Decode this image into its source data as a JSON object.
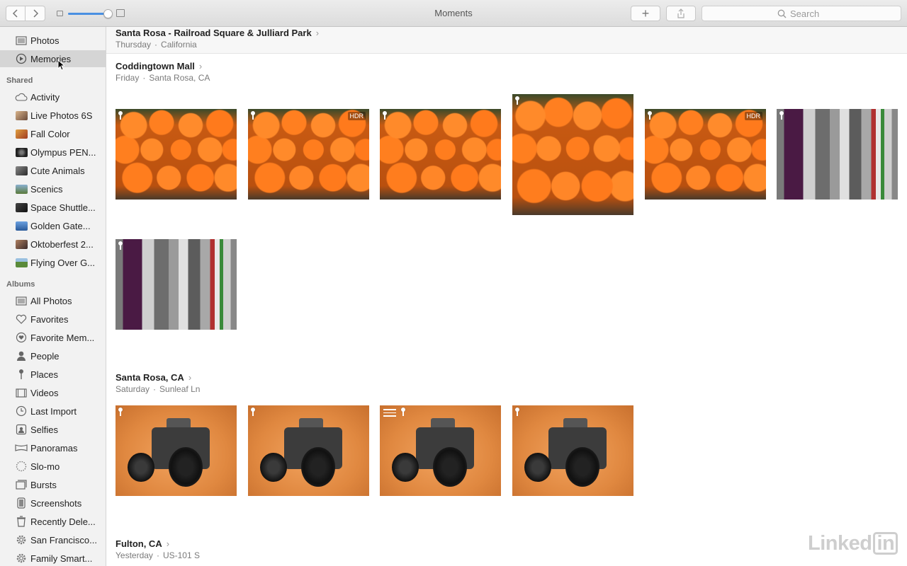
{
  "window": {
    "title": "Moments"
  },
  "toolbar": {
    "back_icon": "chevron-left-icon",
    "forward_icon": "chevron-right-icon",
    "add_label": "+",
    "search_placeholder": "Search"
  },
  "sidebar": {
    "top_items": [
      {
        "label": "Photos",
        "icon": "photos-icon"
      },
      {
        "label": "Memories",
        "icon": "memories-icon",
        "selected": true
      }
    ],
    "shared_heading": "Shared",
    "shared_items": [
      {
        "label": "Activity",
        "icon": "cloud-icon"
      },
      {
        "label": "Live Photos 6S",
        "icon": "album-thumb-icon",
        "color": "#8a6a5a"
      },
      {
        "label": "Fall Color",
        "icon": "album-thumb-icon",
        "color": "#b5652a"
      },
      {
        "label": "Olympus PEN...",
        "icon": "album-thumb-icon",
        "color": "#3a3a3a"
      },
      {
        "label": "Cute Animals",
        "icon": "album-thumb-icon",
        "color": "#4a4a4a"
      },
      {
        "label": "Scenics",
        "icon": "album-thumb-icon",
        "color": "#5a6a4a"
      },
      {
        "label": "Space Shuttle...",
        "icon": "album-thumb-icon",
        "color": "#2a2a3a"
      },
      {
        "label": "Golden Gate...",
        "icon": "album-thumb-icon",
        "color": "#4a7ab0"
      },
      {
        "label": "Oktoberfest 2...",
        "icon": "album-thumb-icon",
        "color": "#6a4a3a"
      },
      {
        "label": "Flying Over G...",
        "icon": "album-thumb-icon",
        "color": "#6a8a4a"
      }
    ],
    "albums_heading": "Albums",
    "album_items": [
      {
        "label": "All Photos",
        "icon": "photos-icon"
      },
      {
        "label": "Favorites",
        "icon": "heart-icon"
      },
      {
        "label": "Favorite Mem...",
        "icon": "favorite-memories-icon"
      },
      {
        "label": "People",
        "icon": "person-icon"
      },
      {
        "label": "Places",
        "icon": "pin-icon"
      },
      {
        "label": "Videos",
        "icon": "video-icon"
      },
      {
        "label": "Last Import",
        "icon": "clock-icon"
      },
      {
        "label": "Selfies",
        "icon": "selfie-icon"
      },
      {
        "label": "Panoramas",
        "icon": "panorama-icon"
      },
      {
        "label": "Slo-mo",
        "icon": "slomo-icon"
      },
      {
        "label": "Bursts",
        "icon": "bursts-icon"
      },
      {
        "label": "Screenshots",
        "icon": "screenshot-icon"
      },
      {
        "label": "Recently Dele...",
        "icon": "trash-icon"
      },
      {
        "label": "San Francisco...",
        "icon": "gear-icon"
      },
      {
        "label": "Family Smart...",
        "icon": "gear-icon"
      }
    ]
  },
  "moments": [
    {
      "title": "Santa Rosa - Railroad Square & Julliard Park",
      "day": "Thursday",
      "place": "California"
    },
    {
      "title": "Coddingtown Mall",
      "day": "Friday",
      "place": "Santa Rosa, CA"
    },
    {
      "title": "Santa Rosa, CA",
      "day": "Saturday",
      "place": "Sunleaf Ln"
    },
    {
      "title": "Fulton, CA",
      "day": "Yesterday",
      "place": "US-101 S"
    }
  ],
  "photos": {
    "hdr_label": "HDR",
    "coddingtown": [
      {
        "kind": "pumpkins",
        "hdr": false
      },
      {
        "kind": "pumpkins",
        "hdr": true
      },
      {
        "kind": "pumpkins",
        "hdr": false
      },
      {
        "kind": "pumpkins",
        "hdr": false
      },
      {
        "kind": "pumpkins",
        "hdr": true
      },
      {
        "kind": "stripes",
        "hdr": false
      },
      {
        "kind": "stripes",
        "hdr": false
      }
    ],
    "santa_rosa": [
      {
        "kind": "camera",
        "adjusted": false
      },
      {
        "kind": "camera",
        "adjusted": false
      },
      {
        "kind": "camera",
        "adjusted": true
      },
      {
        "kind": "camera",
        "adjusted": false
      }
    ]
  },
  "watermark": {
    "text": "Linked",
    "badge": "in"
  }
}
